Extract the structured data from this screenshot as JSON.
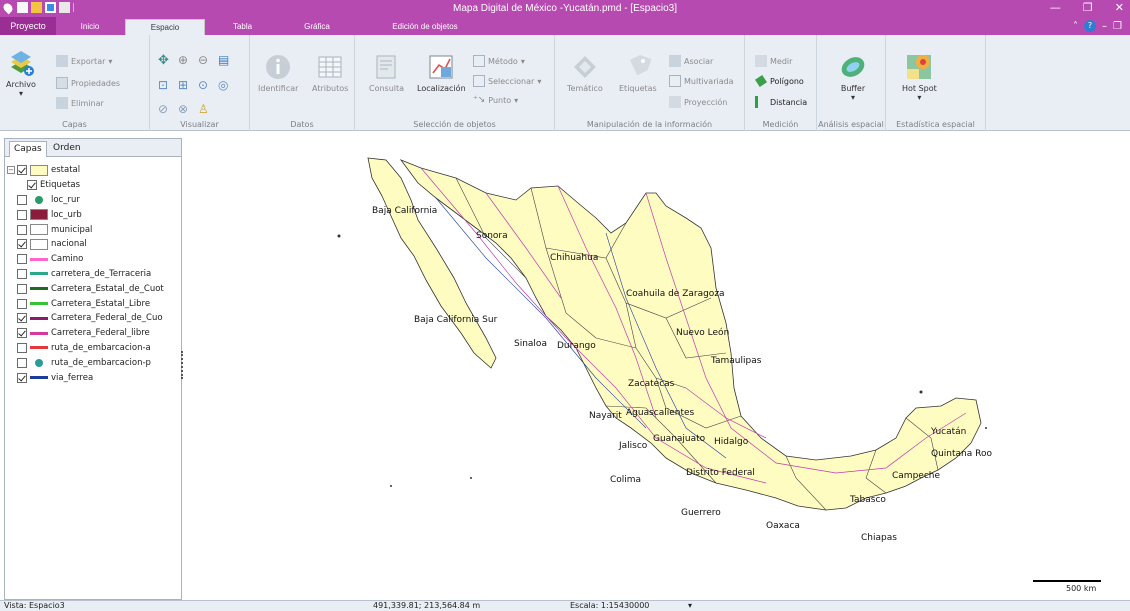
{
  "window": {
    "title": "Mapa Digital de México -Yucatán.pmd - [Espacio3]",
    "controls": [
      "—",
      "❐",
      "✕"
    ]
  },
  "tabs": {
    "file": "Proyecto",
    "items": [
      "Inicio",
      "Espacio",
      "Tabla",
      "Gráfica",
      "Edición de objetos"
    ],
    "active": "Espacio"
  },
  "ribbon": {
    "capas": {
      "label": "Capas",
      "archivo": "Archivo",
      "exportar": "Exportar",
      "propiedades": "Propiedades",
      "eliminar": "Eliminar"
    },
    "visualizar": {
      "label": "Visualizar"
    },
    "datos": {
      "label": "Datos",
      "identificar": "Identificar",
      "atributos": "Atributos"
    },
    "seleccion": {
      "label": "Selección de objetos",
      "consulta": "Consulta",
      "localizacion": "Localización",
      "metodo": "Método",
      "seleccionar": "Seleccionar",
      "punto": "Punto"
    },
    "manipulacion": {
      "label": "Manipulación de la información",
      "tematico": "Temático",
      "etiquetas": "Etiquetas",
      "asociar": "Asociar",
      "multivariada": "Multivariada",
      "proyeccion": "Proyección"
    },
    "medicion": {
      "label": "Medición",
      "medir": "Medir",
      "poligono": "Polígono",
      "distancia": "Distancia"
    },
    "analisis": {
      "label": "Análisis espacial",
      "buffer": "Buffer"
    },
    "estadistica": {
      "label": "Estadística espacial",
      "hotspot": "Hot Spot"
    }
  },
  "panel": {
    "tabs": [
      "Capas",
      "Orden"
    ],
    "layers": [
      {
        "name": "estatal",
        "checked": true,
        "swatch": "#fffcc2",
        "kind": "box",
        "expand": true
      },
      {
        "name": "Etiquetas",
        "checked": true,
        "swatch": "",
        "kind": "none",
        "indent": true
      },
      {
        "name": "loc_rur",
        "checked": false,
        "swatch": "#2a9a6a",
        "kind": "dot"
      },
      {
        "name": "loc_urb",
        "checked": false,
        "swatch": "#8c1c3c",
        "kind": "box"
      },
      {
        "name": "municipal",
        "checked": false,
        "swatch": "#ffffff",
        "kind": "box"
      },
      {
        "name": "nacional",
        "checked": true,
        "swatch": "#ffffff",
        "kind": "box"
      },
      {
        "name": "Camino",
        "checked": false,
        "swatch": "#ff66cc",
        "kind": "line"
      },
      {
        "name": "carretera_de_Terraceria",
        "checked": false,
        "swatch": "#2aa88a",
        "kind": "line"
      },
      {
        "name": "Carretera_Estatal_de_Cuot",
        "checked": false,
        "swatch": "#1f6b1f",
        "kind": "line"
      },
      {
        "name": "Carretera_Estatal_Libre",
        "checked": false,
        "swatch": "#35c435",
        "kind": "line"
      },
      {
        "name": "Carretera_Federal_de_Cuo",
        "checked": true,
        "swatch": "#8c1c6c",
        "kind": "line"
      },
      {
        "name": "Carretera_Federal_libre",
        "checked": true,
        "swatch": "#d9379e",
        "kind": "line"
      },
      {
        "name": "ruta_de_embarcacion-a",
        "checked": false,
        "swatch": "#e23a3a",
        "kind": "line"
      },
      {
        "name": "ruta_de_embarcacion-p",
        "checked": false,
        "swatch": "#2a9a9a",
        "kind": "dot"
      },
      {
        "name": "via_ferrea",
        "checked": true,
        "swatch": "#1c3c9c",
        "kind": "line"
      }
    ]
  },
  "map": {
    "labels": [
      "Baja California",
      "Sonora",
      "Chihuahua",
      "Coahuila de Zaragoza",
      "Baja California Sur",
      "Nuevo León",
      "Sinaloa",
      "Durango",
      "Tamaulipas",
      "Zacatecas",
      "Nayarit",
      "Aguascalientes",
      "Jalisco",
      "Guanajuato",
      "Hidalgo",
      "Distrito Federal",
      "Colima",
      "Guerrero",
      "Oaxaca",
      "Chiapas",
      "Tabasco",
      "Campeche",
      "Yucatán",
      "Quintana Roo"
    ],
    "scale_label": "500 km"
  },
  "status": {
    "vista": "Vista: Espacio3",
    "coords": "491,339.81; 213,564.84 m",
    "escala": "Escala: 1:15430000"
  }
}
